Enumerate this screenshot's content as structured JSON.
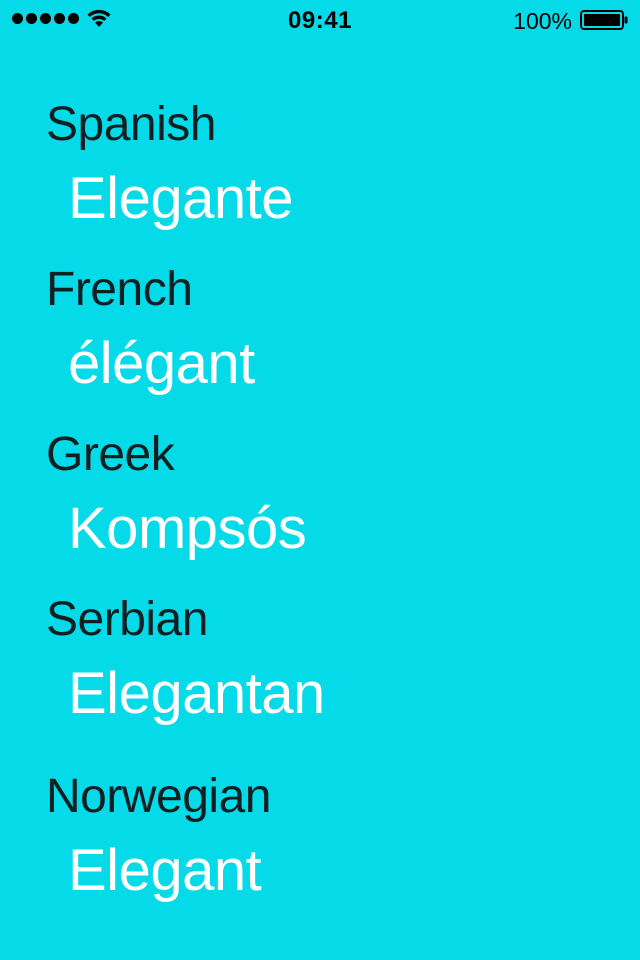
{
  "status_bar": {
    "time": "09:41",
    "battery_percent": "100%",
    "signal_bars": 5,
    "battery_level": 1.0,
    "icons": [
      "signal-dots-icon",
      "wifi-icon",
      "battery-icon"
    ]
  },
  "translations": [
    {
      "language": "Spanish",
      "word": "Elegante"
    },
    {
      "language": "French",
      "word": "élégant"
    },
    {
      "language": "Greek",
      "word": "Kompsós"
    },
    {
      "language": "Serbian",
      "word": "Elegantan"
    },
    {
      "language": "Norwegian",
      "word": "Elegant"
    }
  ],
  "colors": {
    "background": "#05dbe8",
    "language_text": "#0f1f22",
    "word_text": "#ffffff",
    "status_text": "#000000"
  }
}
